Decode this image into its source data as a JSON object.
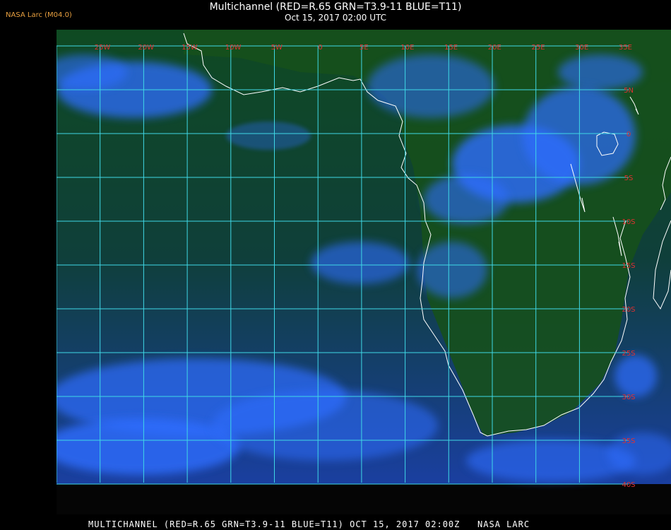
{
  "header": {
    "source_tag": "NASA Larc (M04.0)",
    "title": "Multichannel (RED=R.65 GRN=T3.9-11 BLUE=T11)",
    "subtitle": "Oct 15, 2017 02:00 UTC"
  },
  "map": {
    "longitude_labels": [
      "25W",
      "20W",
      "15W",
      "10W",
      "5W",
      "0",
      "5E",
      "10E",
      "15E",
      "20E",
      "25E",
      "30E",
      "35E"
    ],
    "latitude_labels": [
      "5N",
      "0",
      "5S",
      "10S",
      "15S",
      "20S",
      "25S",
      "30S",
      "35S",
      "40S"
    ],
    "colors": {
      "background": "#000000",
      "ocean_base": "#0d3a2a",
      "land_base": "#124a1c",
      "cloud": "#2f6dff",
      "gridline": "#3fd8e6",
      "grid_label": "#e03030",
      "coastline": "#ffffff",
      "source_tag": "#e8a040"
    }
  },
  "footer": {
    "caption": "MULTICHANNEL (RED=R.65 GRN=T3.9-11 BLUE=T11) OCT 15, 2017 02:00Z   NASA LARC"
  }
}
